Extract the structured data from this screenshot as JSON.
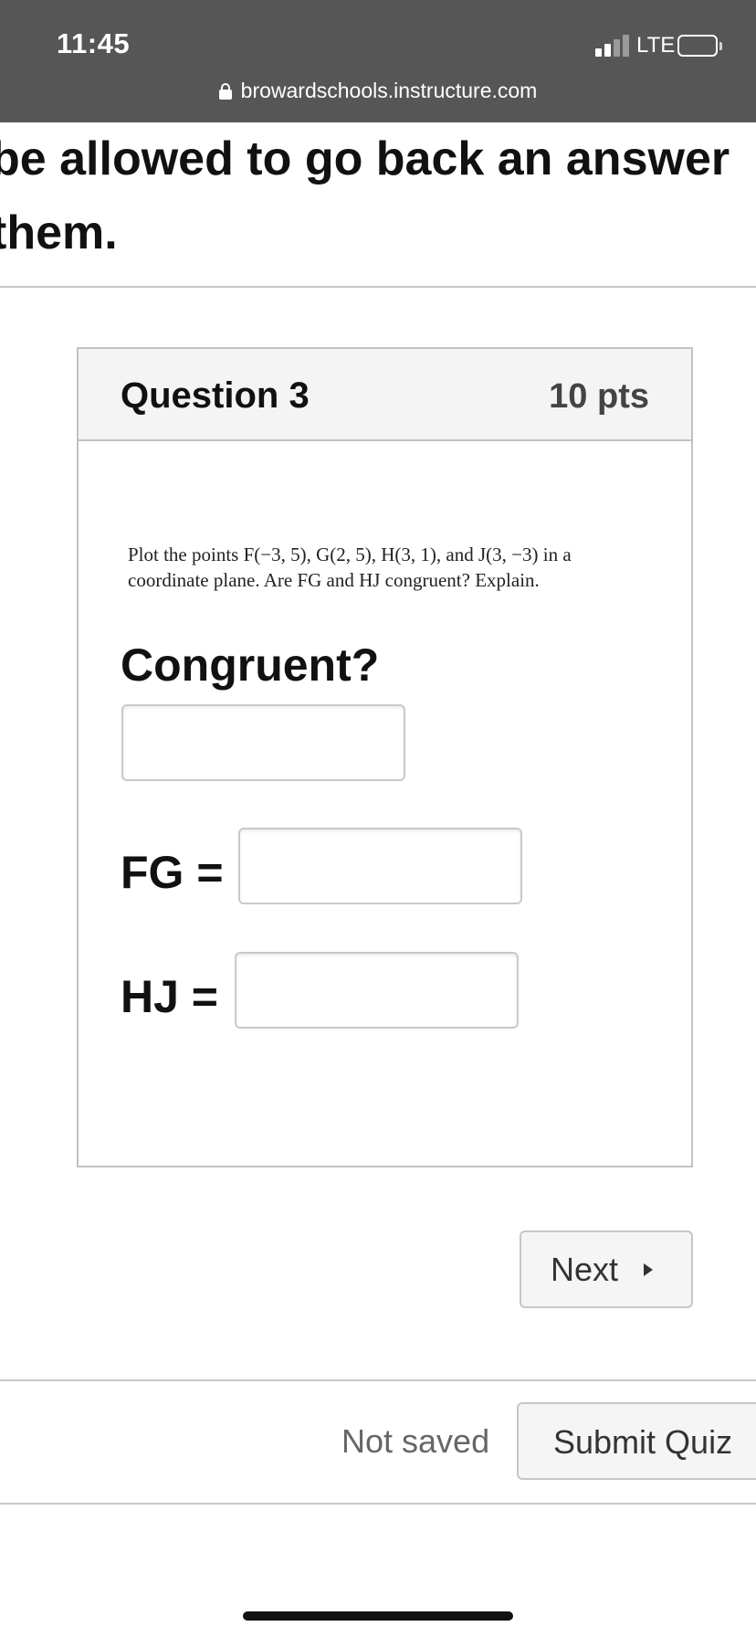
{
  "status_bar": {
    "time": "11:45",
    "network": "LTE",
    "url": "browardschools.instructure.com"
  },
  "instructions": {
    "line1": "be allowed to go back an answer",
    "line2": "them."
  },
  "question": {
    "title": "Question 3",
    "points": "10 pts",
    "text_line1": "Plot the points F(−3, 5), G(2, 5), H(3, 1), and J(3, −3) in a",
    "text_line2": "coordinate plane. Are FG and HJ congruent? Explain.",
    "congruent_label": "Congruent?",
    "congruent_value": "",
    "fg_label": "FG =",
    "fg_value": "",
    "hj_label": "HJ =",
    "hj_value": ""
  },
  "navigation": {
    "next_label": "Next"
  },
  "footer": {
    "save_status": "Not saved",
    "submit_label": "Submit Quiz"
  }
}
